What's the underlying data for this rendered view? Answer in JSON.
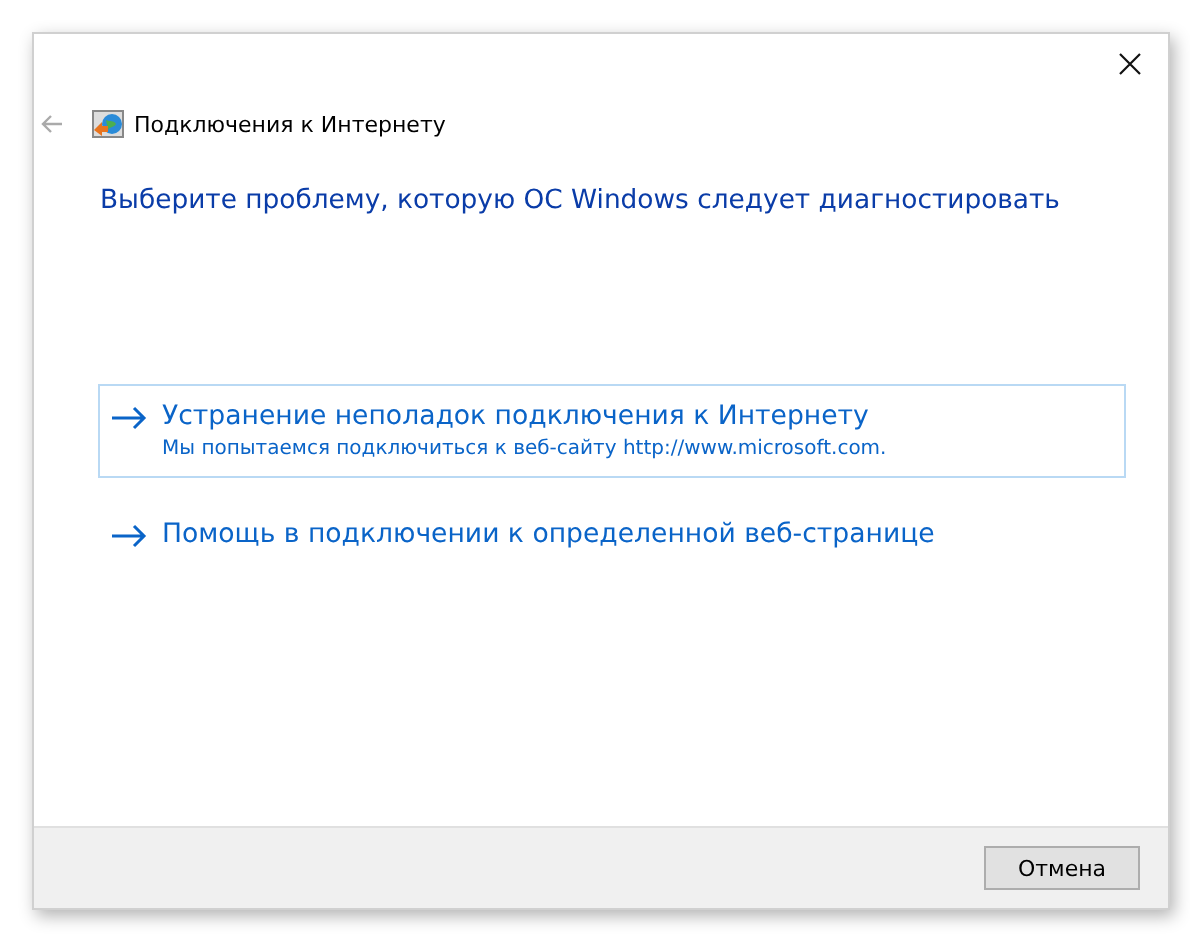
{
  "window": {
    "title": "Подключения к Интернету"
  },
  "heading": "Выберите проблему, которую ОС Windows следует диагностировать",
  "options": [
    {
      "title": "Устранение неполадок подключения к Интернету",
      "description": "Мы попытаемся подключиться к веб-сайту http://www.microsoft.com.",
      "selected": true
    },
    {
      "title": "Помощь в подключении к определенной веб-странице",
      "selected": false
    }
  ],
  "buttons": [
    "Отмена"
  ]
}
